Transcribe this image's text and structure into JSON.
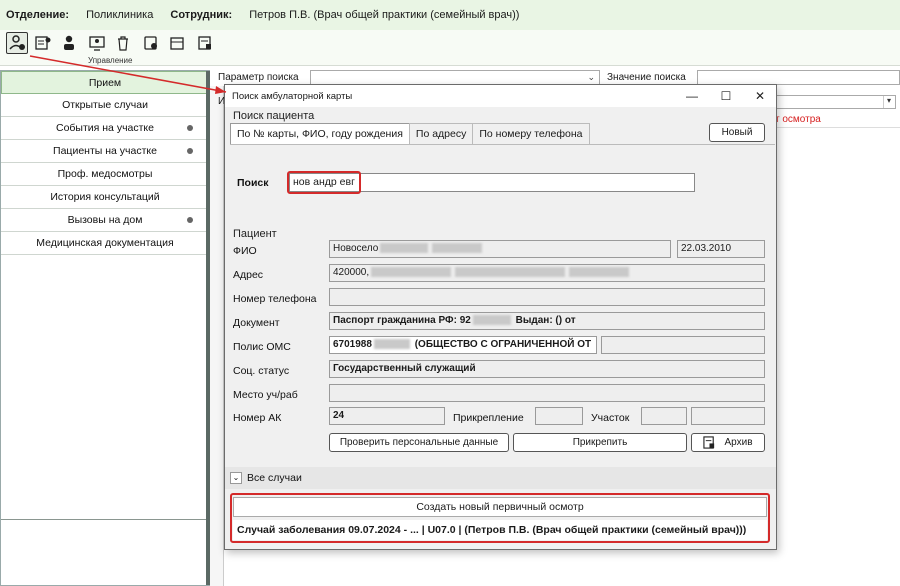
{
  "header": {
    "department_label": "Отделение:",
    "department_value": "Поликлиника",
    "employee_label": "Сотрудник:",
    "employee_value": "Петров П.В. (Врач общей практики (семейный врач))"
  },
  "toolbar": {
    "group_label": "Управление",
    "buttons": [
      "user-search-icon",
      "card-icon",
      "users-icon",
      "monitor-user-icon",
      "trash-icon",
      "copy-icon",
      "calendar-icon",
      "calendar-list-icon"
    ]
  },
  "sidebar": {
    "items": [
      {
        "label": "Прием",
        "active": true,
        "dot": false
      },
      {
        "label": "Открытые случаи",
        "active": false,
        "dot": false
      },
      {
        "label": "События на участке",
        "active": false,
        "dot": true
      },
      {
        "label": "Пациенты на участке",
        "active": false,
        "dot": true
      },
      {
        "label": "Проф. медосмотры",
        "active": false,
        "dot": false
      },
      {
        "label": "История консультаций",
        "active": false,
        "dot": false
      },
      {
        "label": "Вызовы на дом",
        "active": false,
        "dot": true
      },
      {
        "label": "Медицинская документация",
        "active": false,
        "dot": false
      }
    ]
  },
  "main": {
    "search_param_label": "Параметр поиска",
    "search_value_label": "Значение поиска",
    "background_letter": "И",
    "background_red_text": "т осмотра"
  },
  "dialog": {
    "title": "Поиск амбулаторной карты",
    "minimize": "—",
    "maximize": "☐",
    "close": "✕",
    "patient_search_label": "Поиск пациента",
    "tabs": [
      "По № карты, ФИО, году рождения",
      "По адресу",
      "По номеру телефона"
    ],
    "new_button": "Новый",
    "search_label": "Поиск",
    "search_value": "нов андр евг",
    "patient_section_label": "Пациент",
    "fields": {
      "fio_label": "ФИО",
      "fio_value": "Новосело",
      "birth_date": "22.03.2010",
      "address_label": "Адрес",
      "address_value": "420000,",
      "phone_label": "Номер телефона",
      "phone_value": "",
      "document_label": "Документ",
      "document_value": "Паспорт гражданина РФ: 92",
      "document_issued": "Выдан: () от",
      "oms_label": "Полис ОМС",
      "oms_value": "6701988",
      "oms_org": "(ОБЩЕСТВО С ОГРАНИЧЕННОЙ ОТ",
      "soc_label": "Соц. статус",
      "soc_value": "Государственный служащий",
      "work_label": "Место уч/раб",
      "work_value": "",
      "ak_label": "Номер АК",
      "ak_value": "24",
      "attach_label": "Прикрепление",
      "area_label": "Участок"
    },
    "check_button": "Проверить персональные данные",
    "attach_button": "Прикрепить",
    "archive_button": "Архив",
    "all_cases_label": "Все случаи",
    "create_button": "Создать новый первичный осмотр",
    "case_row": "Случай заболевания  09.07.2024 - ... | U07.0 | (Петров П.В. (Врач общей практики (семейный врач)))"
  },
  "colors": {
    "highlight": "#d42a2a",
    "active_item_bg": "#e3f3de",
    "header_bg": "#e9f5e4"
  }
}
